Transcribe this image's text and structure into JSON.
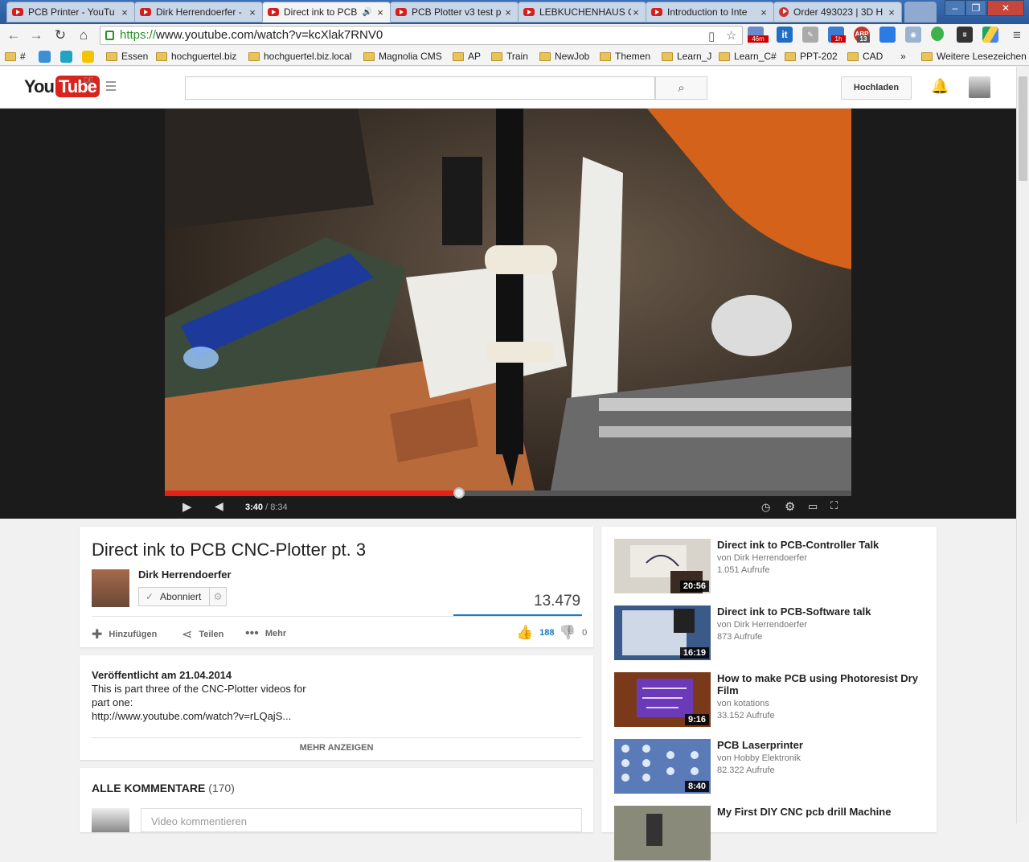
{
  "browser": {
    "tabs": [
      {
        "label": "PCB Printer - YouTu"
      },
      {
        "label": "Dirk Herrendoerfer -"
      },
      {
        "label": "Direct ink to PCB"
      },
      {
        "label": "PCB Plotter v3 test p"
      },
      {
        "label": "LEBKUCHENHAUS C"
      },
      {
        "label": "Introduction to Inte"
      },
      {
        "label": "Order 493023 | 3D H"
      }
    ],
    "url_scheme": "https://",
    "url_rest": "www.youtube.com/watch?v=kcXlak7RNV0",
    "ext_badges": [
      "46m",
      "1h",
      "13"
    ],
    "bookmarks": [
      "#",
      "Essen",
      "hochguertel.biz",
      "hochguertel.biz.local",
      "Magnolia CMS",
      "AP",
      "Train",
      "NewJob",
      "Themen",
      "Learn_J",
      "Learn_C#",
      "PPT-202",
      "CAD",
      "»",
      "Weitere Lesezeichen"
    ]
  },
  "yt": {
    "logo_you": "You",
    "logo_tube": "Tube",
    "logo_region": "DE",
    "upload_label": "Hochladen"
  },
  "player": {
    "time_current": "3:40",
    "time_total": "/ 8:34",
    "progress_fraction": 0.428
  },
  "video": {
    "title": "Direct ink to PCB CNC-Plotter pt. 3",
    "channel": "Dirk Herrendoerfer",
    "subscribe_label": "Abonniert",
    "views": "13.479",
    "actions": {
      "add": "Hinzufügen",
      "share": "Teilen",
      "more": "Mehr"
    },
    "likes": "188",
    "dislikes": "0",
    "published": "Veröffentlicht am 21.04.2014",
    "desc_line1": "This is part three of the CNC-Plotter videos for",
    "desc_line2": "part one:",
    "desc_line3": "http://www.youtube.com/watch?v=rLQajS...",
    "show_more": "MEHR ANZEIGEN"
  },
  "comments": {
    "title": "ALLE KOMMENTARE",
    "count": "(170)",
    "placeholder": "Video kommentieren"
  },
  "related": [
    {
      "title": "Direct ink to PCB-Controller Talk",
      "channel": "von Dirk Herrendoerfer",
      "views": "1.051 Aufrufe",
      "duration": "20:56",
      "color": "#d8d4cc"
    },
    {
      "title": "Direct ink to PCB-Software talk",
      "channel": "von Dirk Herrendoerfer",
      "views": "873 Aufrufe",
      "duration": "16:19",
      "color": "#3a5a8a"
    },
    {
      "title": "How to make PCB using Photoresist Dry Film",
      "channel": "von kotations",
      "views": "33.152 Aufrufe",
      "duration": "9:16",
      "color": "#7a3a1a"
    },
    {
      "title": "PCB Laserprinter",
      "channel": "von Hobby Elektronik",
      "views": "82.322 Aufrufe",
      "duration": "8:40",
      "color": "#5a7ab8"
    },
    {
      "title": "My First DIY CNC pcb drill Machine",
      "channel": "",
      "views": "",
      "duration": "",
      "color": "#8a8a7a"
    }
  ]
}
